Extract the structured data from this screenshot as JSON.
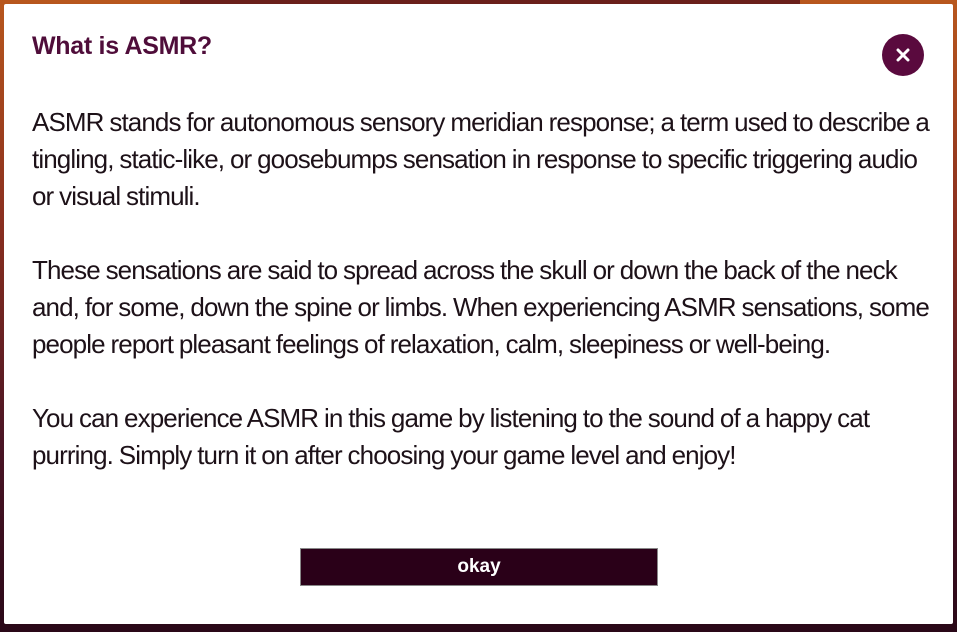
{
  "dialog": {
    "title": "What is ASMR?",
    "close_icon": "close-icon",
    "paragraphs": [
      "ASMR stands for autonomous sensory meridian response; a term used to describe a tingling, static-like, or goosebumps sensation in response to specific triggering audio or visual stimuli.",
      "These sensations are said to spread across the skull or down the back of the neck and, for some, down the spine or limbs. When experiencing ASMR sensations, some people report pleasant feelings of relaxation, calm, sleepiness or well-being.",
      "You can experience ASMR in this game by listening to the sound of a happy cat purring. Simply turn it on after choosing your game level and enjoy!"
    ],
    "okay_label": "okay"
  },
  "colors": {
    "accent": "#5a0a3e",
    "title": "#4f0d3a",
    "button_bg": "#2a0018"
  }
}
